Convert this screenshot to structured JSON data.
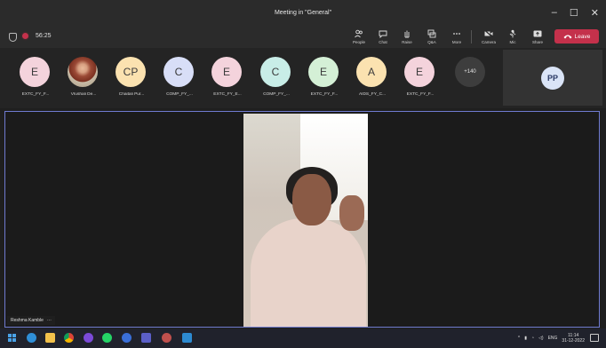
{
  "window": {
    "title": "Meeting in \"General\"",
    "minimize": "–",
    "maximize": "☐",
    "close": "✕"
  },
  "toolbar": {
    "timer": "56:25",
    "buttons": [
      {
        "label": "People",
        "icon": "people-icon"
      },
      {
        "label": "Chat",
        "icon": "chat-icon"
      },
      {
        "label": "Raise",
        "icon": "raise-hand-icon"
      },
      {
        "label": "Q&A",
        "icon": "qa-icon"
      },
      {
        "label": "More",
        "icon": "more-icon"
      },
      {
        "label": "Camera",
        "icon": "camera-icon"
      },
      {
        "label": "Mic",
        "icon": "mic-icon"
      },
      {
        "label": "Share",
        "icon": "share-icon"
      }
    ],
    "leave_label": "Leave",
    "leave_color": "#c4314b"
  },
  "participants": [
    {
      "initials": "E",
      "name": "EXTC_FY_F...",
      "color": "#f4d3dc"
    },
    {
      "initials": "",
      "name": "Vrushali De...",
      "color": "photo"
    },
    {
      "initials": "CP",
      "name": "Chaitali Pur...",
      "color": "#fbe2b0"
    },
    {
      "initials": "C",
      "name": "COMP_FY_...",
      "color": "#d8def7"
    },
    {
      "initials": "E",
      "name": "EXTC_FY_E...",
      "color": "#f4d3dc"
    },
    {
      "initials": "C",
      "name": "COMP_FY_...",
      "color": "#c8ede7"
    },
    {
      "initials": "E",
      "name": "EXTC_FY_F...",
      "color": "#d4f0d6"
    },
    {
      "initials": "A",
      "name": "AIDS_FY_C...",
      "color": "#fbe2b0"
    },
    {
      "initials": "E",
      "name": "EXTC_FY_F...",
      "color": "#f4d3dc"
    }
  ],
  "more_participants": "+140",
  "self": {
    "initials": "PP"
  },
  "stage": {
    "speaker_name": "Reshma Kamble",
    "speaker_menu": "···"
  },
  "taskbar": {
    "apps": [
      "windows-icon",
      "edge-icon",
      "file-explorer-icon",
      "chrome-icon",
      "app-icon",
      "whatsapp-icon",
      "app-icon",
      "teams-icon",
      "app-icon",
      "app-icon"
    ],
    "language": "ENG",
    "time": "11:14",
    "date": "31-12-2022"
  }
}
